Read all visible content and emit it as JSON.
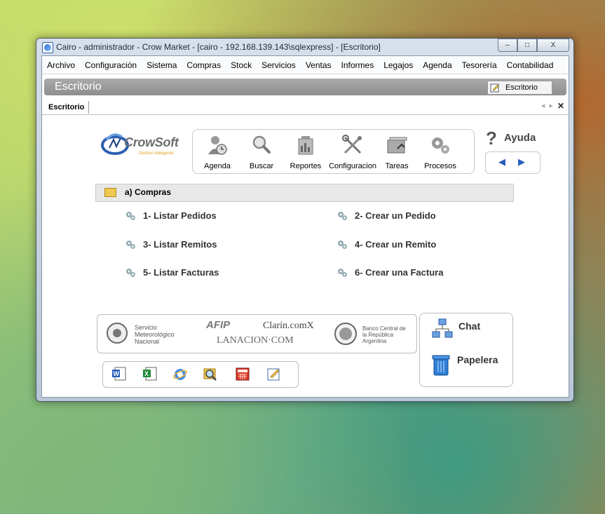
{
  "window": {
    "title": "Cairo - administrador - Crow Market - [cairo - 192.168.139.143\\sqlexpress] - [Escritorio]",
    "controls": {
      "minimize": "–",
      "maximize": "□",
      "close": "X"
    }
  },
  "menu": [
    "Archivo",
    "Configuración",
    "Sistema",
    "Compras",
    "Stock",
    "Servicios",
    "Ventas",
    "Informes",
    "Legajos",
    "Agenda",
    "Tesorería",
    "Contabilidad"
  ],
  "panel": {
    "title": "Escritorio",
    "button_label": "Escritorio"
  },
  "tab": {
    "label": "Escritorio"
  },
  "logo": {
    "name": "CrowSoft",
    "tagline": "Gestion inteligente"
  },
  "toolbar": [
    {
      "label": "Agenda",
      "icon": "agenda-clock-icon"
    },
    {
      "label": "Buscar",
      "icon": "magnifier-icon"
    },
    {
      "label": "Reportes",
      "icon": "reports-icon"
    },
    {
      "label": "Configuracion",
      "icon": "tools-icon"
    },
    {
      "label": "Tareas",
      "icon": "tasks-icon"
    },
    {
      "label": "Procesos",
      "icon": "gears-icon"
    }
  ],
  "help": {
    "label": "Ayuda",
    "prev": "◀",
    "next": "▶"
  },
  "section": {
    "title": "a) Compras"
  },
  "links": [
    {
      "label": "1- Listar Pedidos"
    },
    {
      "label": "2- Crear un Pedido"
    },
    {
      "label": "3- Listar Remitos"
    },
    {
      "label": "4- Crear un Remito"
    },
    {
      "label": "5- Listar Facturas"
    },
    {
      "label": "6- Crear una Factura"
    }
  ],
  "sponsors": {
    "smn": "Servicio\nMeteorológico\nNacional",
    "afip": "AFIP",
    "clarin": "Clarín.comX",
    "lanacion": "LANACION·COM",
    "bcra": "Banco Central de\nla República\nArgentina"
  },
  "side": {
    "chat": "Chat",
    "trash": "Papelera"
  },
  "apps": [
    "word-icon",
    "excel-icon",
    "internet-explorer-icon",
    "search-file-icon",
    "calculator-icon",
    "notepad-icon"
  ]
}
